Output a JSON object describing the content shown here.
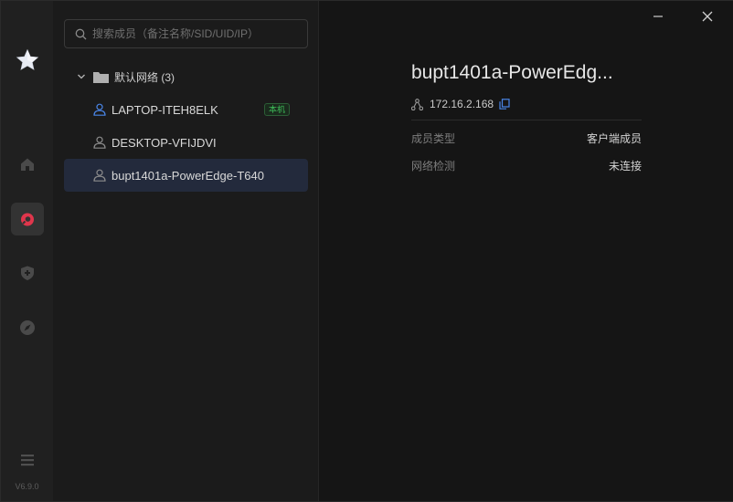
{
  "rail": {
    "version": "V6.9.0",
    "nav": [
      {
        "icon": "home-icon"
      },
      {
        "icon": "network-icon",
        "active": true
      },
      {
        "icon": "shield-plus-icon"
      },
      {
        "icon": "compass-icon"
      }
    ],
    "menu_icon": "menu-icon",
    "logo_icon": "star-logo-icon"
  },
  "search": {
    "placeholder": "搜索成员（备注名称/SID/UID/IP）"
  },
  "group": {
    "label": "默认网络 (3)"
  },
  "members": [
    {
      "name": "LAPTOP-ITEH8ELK",
      "badge": "本机",
      "online": true
    },
    {
      "name": "DESKTOP-VFIJDVI",
      "online": false
    },
    {
      "name": "bupt1401a-PowerEdge-T640",
      "online": false,
      "selected": true
    }
  ],
  "detail": {
    "title": "bupt1401a-PowerEdg...",
    "ip": "172.16.2.168",
    "rows": [
      {
        "key": "成员类型",
        "value": "客户端成员"
      },
      {
        "key": "网络检测",
        "value": "未连接"
      }
    ]
  },
  "colors": {
    "accent": "#e0364c",
    "online_blue": "#4a86e8",
    "badge_green": "#3fbf5a",
    "selected_bg": "#232a3c"
  }
}
